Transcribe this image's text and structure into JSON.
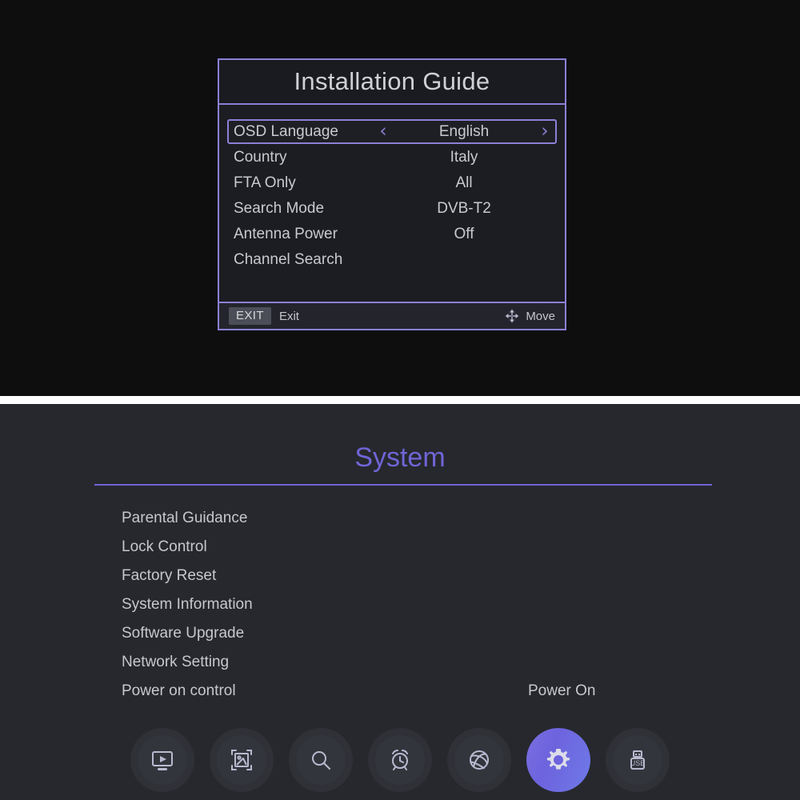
{
  "top_panel": {
    "dialog": {
      "title": "Installation Guide",
      "rows": [
        {
          "label": "OSD Language",
          "value": "English",
          "selected": true,
          "has_arrows": true
        },
        {
          "label": "Country",
          "value": "Italy",
          "selected": false,
          "has_arrows": false
        },
        {
          "label": "FTA Only",
          "value": "All",
          "selected": false,
          "has_arrows": false
        },
        {
          "label": "Search Mode",
          "value": "DVB-T2",
          "selected": false,
          "has_arrows": false
        },
        {
          "label": "Antenna Power",
          "value": "Off",
          "selected": false,
          "has_arrows": false
        },
        {
          "label": "Channel Search",
          "value": "",
          "selected": false,
          "has_arrows": false
        }
      ],
      "arrow_left": "‹",
      "arrow_right": "›",
      "footer": {
        "exit_key": "EXIT",
        "exit_label": "Exit",
        "move_label": "Move",
        "move_icon": "move-arrows-icon"
      }
    }
  },
  "bottom_panel": {
    "title": "System",
    "items": [
      {
        "label": "Parental Guidance",
        "value": ""
      },
      {
        "label": "Lock Control",
        "value": ""
      },
      {
        "label": "Factory Reset",
        "value": ""
      },
      {
        "label": "System Information",
        "value": ""
      },
      {
        "label": "Software Upgrade",
        "value": ""
      },
      {
        "label": "Network Setting",
        "value": ""
      },
      {
        "label": "Power on control",
        "value": "Power On"
      }
    ],
    "dock": [
      {
        "icon": "tv-play-icon",
        "active": false
      },
      {
        "icon": "picture-crop-icon",
        "active": false
      },
      {
        "icon": "search-icon",
        "active": false
      },
      {
        "icon": "alarm-clock-icon",
        "active": false
      },
      {
        "icon": "globe-icon",
        "active": false
      },
      {
        "icon": "gear-icon",
        "active": true
      },
      {
        "icon": "usb-icon",
        "active": false
      }
    ]
  },
  "colors": {
    "accent_purple": "#8b80d6",
    "title_purple": "#6f65d6",
    "active_button": "#6d63dd",
    "text_light": "#c7c8cc",
    "panel_top_bg": "#0e0e0f",
    "panel_bottom_bg": "#26282d",
    "dialog_bg": "#1c1d22"
  }
}
